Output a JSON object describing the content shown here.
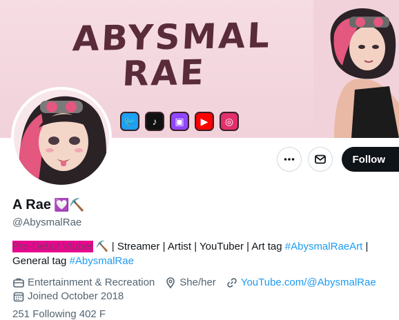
{
  "banner": {
    "title_line1": "ABYSMAL",
    "title_line2": "RAE",
    "social_icons": [
      "twitter-icon",
      "tiktok-icon",
      "twitch-icon",
      "youtube-icon",
      "instagram-icon"
    ],
    "social_colors": [
      "#1da1f2",
      "#111111",
      "#9146ff",
      "#ff0000",
      "#e1306c"
    ]
  },
  "actions": {
    "more_label": "•••",
    "follow_label": "Follow"
  },
  "profile": {
    "display_name": "A Rae",
    "name_emojis": "💟⛏️",
    "handle": "@AbysmalRae",
    "bio": {
      "highlight": "Pre-Debut Vtuber",
      "pick": "⛏️",
      "text1": " | Streamer | Artist | YouTuber | Art tag ",
      "tag1": "#AbysmalRaeArt",
      "text2": " | General tag ",
      "tag2": "#AbysmalRae"
    },
    "category": "Entertainment & Recreation",
    "pronouns": "She/her",
    "website": "YouTube.com/@AbysmalRae",
    "joined": "Joined October 2018",
    "counts_partial": "251 Following  402 F"
  },
  "colors": {
    "accent": "#1d9bf0",
    "highlight": "#e8088f",
    "follow_bg": "#0f1419",
    "banner_bg": "#f3d6dd"
  }
}
